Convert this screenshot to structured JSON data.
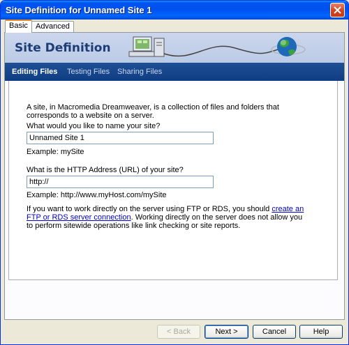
{
  "window": {
    "title": "Site Definition for Unnamed Site 1"
  },
  "tabs": [
    {
      "label": "Basic"
    },
    {
      "label": "Advanced"
    }
  ],
  "banner": {
    "title": "Site Definition"
  },
  "nav": [
    {
      "label": "Editing Files"
    },
    {
      "label": "Testing Files"
    },
    {
      "label": "Sharing Files"
    }
  ],
  "form": {
    "intro": "A site, in Macromedia Dreamweaver, is a collection of files and folders that corresponds to a website on a server.",
    "name_question": "What would you like to name your site?",
    "name_value": "Unnamed Site 1",
    "name_example": "Example: mySite",
    "url_question": "What is the HTTP Address (URL) of your site?",
    "url_value": "http://",
    "url_example": "Example: http://www.myHost.com/mySite",
    "ftp_text_before": "If you want to work directly on the server using FTP or RDS, you should ",
    "ftp_link": "create an FTP or RDS server connection",
    "ftp_text_after": ".  Working directly on the server does not allow you to perform sitewide operations like link checking or site reports."
  },
  "buttons": {
    "back": "< Back",
    "next": "Next >",
    "cancel": "Cancel",
    "help": "Help"
  },
  "colors": {
    "titlebar": "#0053ee",
    "navbar": "#1f4f95",
    "banner": "#cbd6ed",
    "link": "#0000cc"
  },
  "icons": [
    "close-icon",
    "computer-icon",
    "globe-icon"
  ]
}
